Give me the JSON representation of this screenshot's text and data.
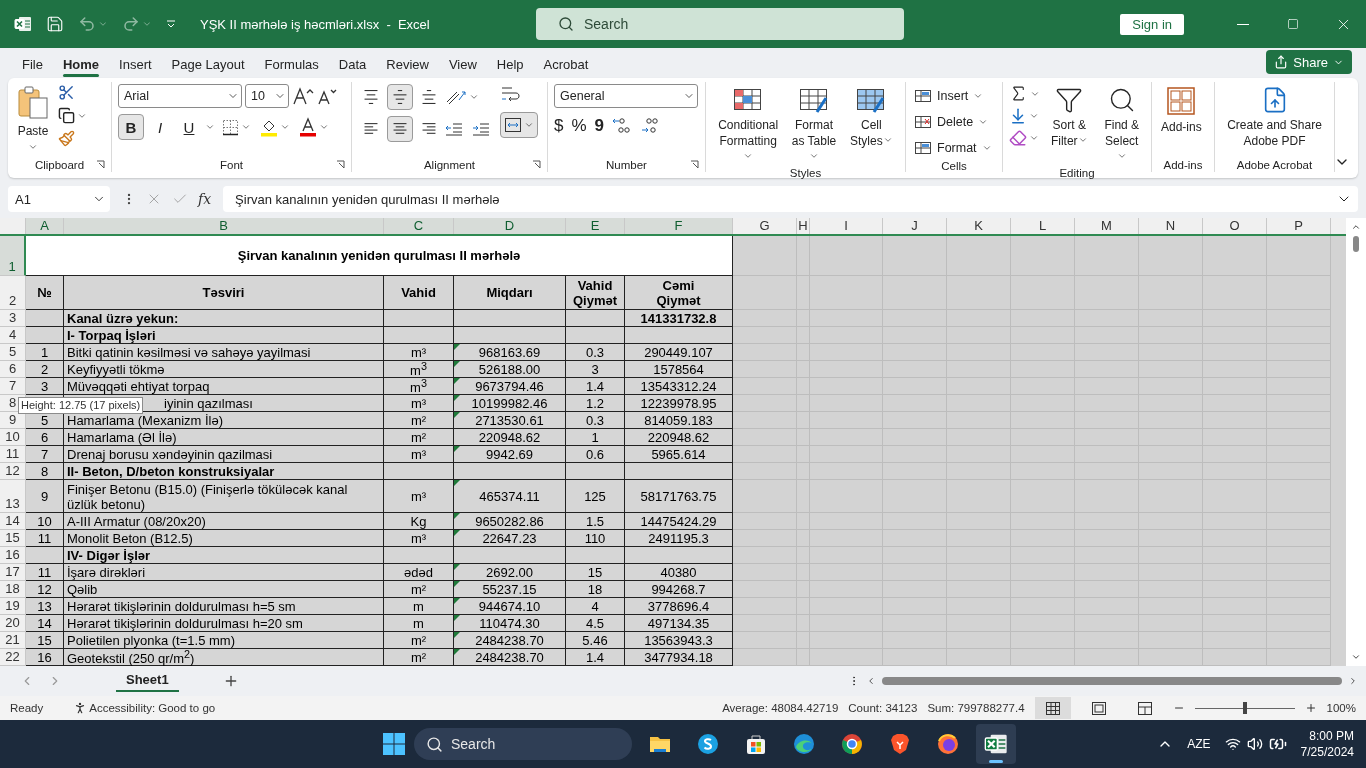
{
  "title_bar": {
    "title": "YŞK II mərhələ iş həcmləri.xlsx  -  Excel",
    "search_placeholder": "Search",
    "sign_in": "Sign in"
  },
  "menu_tabs": [
    {
      "label": "File",
      "selected": false
    },
    {
      "label": "Home",
      "selected": true
    },
    {
      "label": "Insert",
      "selected": false
    },
    {
      "label": "Page Layout",
      "selected": false
    },
    {
      "label": "Formulas",
      "selected": false
    },
    {
      "label": "Data",
      "selected": false
    },
    {
      "label": "Review",
      "selected": false
    },
    {
      "label": "View",
      "selected": false
    },
    {
      "label": "Help",
      "selected": false
    },
    {
      "label": "Acrobat",
      "selected": false
    }
  ],
  "share": "Share",
  "ribbon": {
    "clipboard": {
      "label": "Clipboard",
      "paste": "Paste"
    },
    "font": {
      "label": "Font",
      "font_name": "Arial",
      "font_size": "10",
      "styles": [
        {
          "label": "B",
          "on": true
        },
        {
          "label": "I",
          "on": false
        },
        {
          "label": "U",
          "on": false
        }
      ]
    },
    "alignment": {
      "label": "Alignment",
      "vertical": [
        {
          "kind": "top",
          "on": false
        },
        {
          "kind": "middle",
          "on": true
        },
        {
          "kind": "bottom",
          "on": false
        }
      ],
      "horizontal": [
        {
          "kind": "left",
          "on": false
        },
        {
          "kind": "center",
          "on": true
        },
        {
          "kind": "right",
          "on": false
        }
      ],
      "merge_on": true
    },
    "number": {
      "label": "Number",
      "format": "General",
      "symbols": [
        "$",
        "%",
        "9"
      ]
    },
    "styles": {
      "label": "Styles",
      "buttons": [
        "Conditional Formatting",
        "Format as Table",
        "Cell Styles"
      ]
    },
    "cells": {
      "label": "Cells",
      "buttons": [
        "Insert",
        "Delete",
        "Format"
      ]
    },
    "editing": {
      "label": "Editing",
      "buttons": [
        "Sort & Filter",
        "Find & Select"
      ]
    },
    "addins": {
      "label": "Add-ins",
      "button": "Add-ins"
    },
    "acrobat": {
      "label": "Adobe Acrobat",
      "button": "Create and Share Adobe PDF"
    }
  },
  "formula_bar": {
    "cell": "A1",
    "fx": "fx",
    "value": "Şirvan kanalının yenidən qurulması II mərhələ"
  },
  "column_headers": [
    {
      "label": "A",
      "selected": true
    },
    {
      "label": "B",
      "selected": true
    },
    {
      "label": "C",
      "selected": true
    },
    {
      "label": "D",
      "selected": true
    },
    {
      "label": "E",
      "selected": true
    },
    {
      "label": "F",
      "selected": true
    },
    {
      "label": "G",
      "selected": false
    },
    {
      "label": "H",
      "selected": false
    },
    {
      "label": "I",
      "selected": false
    },
    {
      "label": "J",
      "selected": false
    },
    {
      "label": "K",
      "selected": false
    },
    {
      "label": "L",
      "selected": false
    },
    {
      "label": "M",
      "selected": false
    },
    {
      "label": "N",
      "selected": false
    },
    {
      "label": "O",
      "selected": false
    },
    {
      "label": "P",
      "selected": false
    }
  ],
  "rows": [
    {
      "n": "1",
      "kind": "title",
      "selected": true,
      "text": "Şirvan kanalının yenidən qurulması II mərhələ"
    },
    {
      "n": "2",
      "kind": "header",
      "selected": false,
      "no": "№",
      "description": "Təsviri",
      "unit": "Vahid",
      "quantity": "Miqdarı",
      "unit_price": "Vahid Qiymət",
      "total": "Cəmi Qiymət"
    },
    {
      "n": "3",
      "kind": "section",
      "selected": false,
      "description": "Kanal üzrə yekun:",
      "total": "141331732.8"
    },
    {
      "n": "4",
      "kind": "section",
      "selected": false,
      "description": "I- Torpaq İşləri"
    },
    {
      "n": "5",
      "kind": "item",
      "selected": false,
      "flag": true,
      "no": "1",
      "description": "Bitki qatinin kəsilməsi və sahəyə yayilmasi",
      "unit": "m³",
      "quantity": "968163.69",
      "unit_price": "0.3",
      "total": "290449.107"
    },
    {
      "n": "6",
      "kind": "item",
      "selected": false,
      "flag": true,
      "no": "2",
      "description": "Keyfiyyətli tökmə",
      "unit": "m$^{3}$",
      "quantity": "526188.00",
      "unit_price": "3",
      "total": "1578564"
    },
    {
      "n": "7",
      "kind": "item",
      "selected": false,
      "flag": true,
      "no": "3",
      "description": "Müvəqqəti ehtiyat torpaq",
      "unit": "m$^{3}$",
      "quantity": "9673794.46",
      "unit_price": "1.4",
      "total": "13543312.24"
    },
    {
      "n": "8",
      "kind": "covered",
      "selected": false,
      "flag": true,
      "description": "iyinin qazılması",
      "unit": "m³",
      "quantity": "10199982.46",
      "unit_price": "1.2",
      "total": "12239978.95"
    },
    {
      "n": "9",
      "kind": "item",
      "selected": false,
      "flag": true,
      "no": "5",
      "description": "Hamarlama (Mexanizm İlə)",
      "unit": "m²",
      "quantity": "2713530.61",
      "unit_price": "0.3",
      "total": "814059.183"
    },
    {
      "n": "10",
      "kind": "item",
      "selected": false,
      "flag": false,
      "no": "6",
      "description": "Hamarlama (Əl İlə)",
      "unit": "m²",
      "quantity": "220948.62",
      "unit_price": "1",
      "total": "220948.62"
    },
    {
      "n": "11",
      "kind": "item",
      "selected": false,
      "flag": true,
      "no": "7",
      "description": "Drenaj borusu xəndəyinin qazilmasi",
      "unit": "m³",
      "quantity": "9942.69",
      "unit_price": "0.6",
      "total": "5965.614"
    },
    {
      "n": "12",
      "kind": "section",
      "selected": false,
      "no": "8",
      "description": "II- Beton, D/beton konstruksiyalar"
    },
    {
      "n": "13",
      "kind": "tall",
      "selected": false,
      "flag": true,
      "no": "9",
      "description": "Finişer Betonu (B15.0) (Finişerlə töküləcək kanal üzlük betonu)",
      "unit": "m³",
      "quantity": "465374.11",
      "unit_price": "125",
      "total": "58171763.75"
    },
    {
      "n": "14",
      "kind": "item",
      "selected": false,
      "flag": true,
      "no": "10",
      "description": "A-III Armatur (08/20x20)",
      "unit": "Kg",
      "quantity": "9650282.86",
      "unit_price": "1.5",
      "total": "14475424.29"
    },
    {
      "n": "15",
      "kind": "item",
      "selected": false,
      "flag": true,
      "no": "11",
      "description": "Monolit Beton (B12.5)",
      "unit": "m³",
      "quantity": "22647.23",
      "unit_price": "110",
      "total": "2491195.3"
    },
    {
      "n": "16",
      "kind": "section",
      "selected": false,
      "description": "IV- Digər İşlər"
    },
    {
      "n": "17",
      "kind": "item",
      "selected": false,
      "flag": true,
      "no": "11",
      "description": "İşarə dirəkləri",
      "unit": "ədəd",
      "quantity": "2692.00",
      "unit_price": "15",
      "total": "40380"
    },
    {
      "n": "18",
      "kind": "item",
      "selected": false,
      "flag": true,
      "no": "12",
      "description": "Qəlib",
      "unit": "m²",
      "quantity": "55237.15",
      "unit_price": "18",
      "total": "994268.7"
    },
    {
      "n": "19",
      "kind": "item",
      "selected": false,
      "flag": true,
      "no": "13",
      "description": "Hərarət tikişlərinin doldurulması h=5 sm",
      "unit": "m",
      "quantity": "944674.10",
      "unit_price": "4",
      "total": "3778696.4"
    },
    {
      "n": "20",
      "kind": "item",
      "selected": false,
      "flag": true,
      "no": "14",
      "description": "Hərarət tikişlərinin doldurulması h=20 sm",
      "unit": "m",
      "quantity": "110474.30",
      "unit_price": "4.5",
      "total": "497134.35"
    },
    {
      "n": "21",
      "kind": "item",
      "selected": false,
      "flag": true,
      "no": "15",
      "description": "Polietilen plyonka (t=1.5 mm)",
      "unit": "m²",
      "quantity": "2484238.70",
      "unit_price": "5.46",
      "total": "13563943.3"
    },
    {
      "n": "22",
      "kind": "item",
      "selected": false,
      "flag": true,
      "no": "16",
      "description": "Geotekstil (250 qr/m$^{2}$)",
      "unit": "m²",
      "quantity": "2484238.70",
      "unit_price": "1.4",
      "total": "3477934.18"
    }
  ],
  "tooltip": "Height: 12.75 (17 pixels)",
  "sheet_tabs": [
    {
      "label": "Sheet1",
      "selected": true
    }
  ],
  "status_bar": {
    "ready": "Ready",
    "accessibility": "Accessibility: Good to go",
    "average": "Average: 48084.42719",
    "count": "Count: 34123",
    "sum": "Sum: 799788277.4",
    "views": [
      {
        "kind": "normal",
        "selected": true
      },
      {
        "kind": "page_layout",
        "selected": false
      },
      {
        "kind": "page_break",
        "selected": false
      }
    ],
    "zoom": {
      "level": 0.5,
      "label": "100%"
    }
  },
  "taskbar": {
    "search": "Search",
    "apps": [
      {
        "kind": "files",
        "active": false
      },
      {
        "kind": "skype",
        "active": false
      },
      {
        "kind": "store",
        "active": false
      },
      {
        "kind": "edge",
        "active": false
      },
      {
        "kind": "chrome",
        "active": false
      },
      {
        "kind": "brave",
        "active": false
      },
      {
        "kind": "firefox",
        "active": false
      },
      {
        "kind": "excel",
        "active": true
      }
    ],
    "language": "AZE",
    "time": "8:00 PM",
    "date": "7/25/2024"
  }
}
